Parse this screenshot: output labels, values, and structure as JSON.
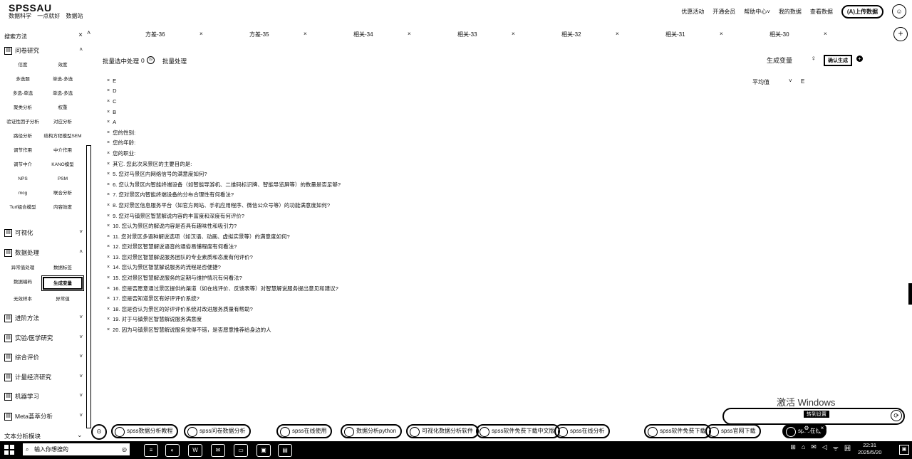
{
  "header": {
    "logo": "SPSSAU",
    "tagline": [
      "数据科学",
      "一点就好",
      "数据站"
    ],
    "nav": [
      "优惠活动",
      "开通会员",
      "帮助中心",
      "我的数据",
      "查看数据"
    ],
    "nav_dropdown_chevron": "˅",
    "pill_label": "(A)上传数据",
    "avatar_glyph": "☺"
  },
  "sidebar": {
    "search_label": "搜索方法",
    "search_close": "×",
    "sections": [
      {
        "label": "问卷研究",
        "icon": "▤",
        "chev": "˄"
      },
      {
        "label": "可视化",
        "icon": "▤",
        "chev": "˅"
      },
      {
        "label": "数据处理",
        "icon": "▤",
        "chev": "˄"
      },
      {
        "label": "进阶方法",
        "icon": "▤",
        "chev": "˅"
      },
      {
        "label": "实验/医学研究",
        "icon": "▤",
        "chev": "˅"
      },
      {
        "label": "综合评价",
        "icon": "▤",
        "chev": "˅"
      },
      {
        "label": "计量经济研究",
        "icon": "▤",
        "chev": "˅"
      },
      {
        "label": "机器学习",
        "icon": "▤",
        "chev": "˅"
      },
      {
        "label": "Meta荟萃分析",
        "icon": "▤",
        "chev": "˅"
      }
    ],
    "questionnaire_items": [
      "信度",
      "效度",
      "多选题",
      "单选-多选",
      "多选-单选",
      "单选-多选",
      "聚类分析",
      "权重",
      "验证性因子分析",
      "对应分析",
      "路径分析",
      "结构方程模型SEM",
      "调节作用",
      "中介作用",
      "调节中介",
      "KANO模型",
      "NPS",
      "PSM",
      "mcg",
      "联合分析",
      "Turf组合模型",
      "内容效度"
    ],
    "data_items": [
      "异常值处理",
      "数据标签",
      "数据编码",
      "生成变量",
      "无效样本",
      "异常值"
    ],
    "data_items_selected_index": 3,
    "footer_label": "文本分析模块",
    "footer_chev": "⌄"
  },
  "tabs": {
    "scroll_up": "˄",
    "items": [
      "方差-36",
      "方差-35",
      "相关-34",
      "相关-33",
      "相关-32",
      "相关-31",
      "相关-30"
    ],
    "close": "×",
    "add": "+"
  },
  "toolbar": {
    "batch_label": "批量选中处理",
    "batch_count": "0",
    "batch_clock": "◷",
    "batch_process": "批量处理",
    "generate_label": "生成变量",
    "bulb": "♀",
    "generate_button": "确认生成",
    "plus": "+"
  },
  "aggregate": {
    "label": "平均值",
    "chev": "˅",
    "value": "E"
  },
  "variables": [
    "E",
    "D",
    "C",
    "B",
    "A",
    "您的性别:",
    "您的年龄:",
    "您的职业:",
    "其它. 您此次来景区的主要目的是:",
    "5. 您对马景区内网络信号的满意度如何?",
    "6. 您认为景区内智能终端设备（如智能导游机、二维码标识牌、智能导览屏等）的数量是否足够?",
    "7. 您对景区内智能终端设备的分布合理性有何看法?",
    "8. 您对景区信息服务平台（如官方网站、手机应用程序、微信公众号等）的功能满意度如何?",
    "9. 您对马镇景区智慧解说内容的丰富度和深度有何评价?",
    "10. 您认为景区的解说内容是否具有趣味性和吸引力?",
    "11. 您对景区多语种解说选项（如汉语、动画、虚拟实景等）的满意度如何?",
    "12. 您对景区智慧解说语音的通俗易懂程度有何看法?",
    "13. 您对景区智慧解说服务团队的专业素质和态度有何评价?",
    "14. 您认为景区智慧解说服务的流程是否便捷?",
    "15. 您对景区智慧解说服务的定期与维护情况有何看法?",
    "16. 您是否愿意通过景区提供的渠道（如在线评价、反馈表等）对智慧解说服务提出意见和建议?",
    "17. 您是否知道景区有好评评价系统?",
    "18. 您是否认为景区的好评评价系统对改进服务质量有帮助?",
    "19. 对于马镇景区智慧解说服务满意度",
    "20. 因为马镇景区智慧解说服务觉得不错，是否愿意推荐给身边的人"
  ],
  "var_remove": "×",
  "watermark": {
    "text": "激活 Windows",
    "tag": "转到设置",
    "icon": "⟳"
  },
  "bottom_links": {
    "lead_icon": "⊙",
    "items": [
      "spss数据分析教程",
      "spss问卷数据分析",
      "spss在线使用",
      "数据分析python",
      "可视化数据分析软件",
      "spss软件免费下载中文版",
      "spss在线分析",
      "spss软件免费下载",
      "spss官网下载",
      "spss在线"
    ],
    "dark_index": 9,
    "extra1": "⚙",
    "extra2": "×"
  },
  "taskbar": {
    "search_placeholder": "输入你想搜的",
    "search_icon": "⌕",
    "camera_icon": "◎",
    "apps": [
      "≡",
      "◐",
      "W",
      "✉",
      "▭",
      "▣",
      "▤"
    ],
    "tray": [
      "⊞",
      "⌂",
      "✉",
      "◁",
      "ᯤ",
      "囲"
    ],
    "time": "22:31",
    "date": "2025/5/20",
    "notif": "▣"
  }
}
